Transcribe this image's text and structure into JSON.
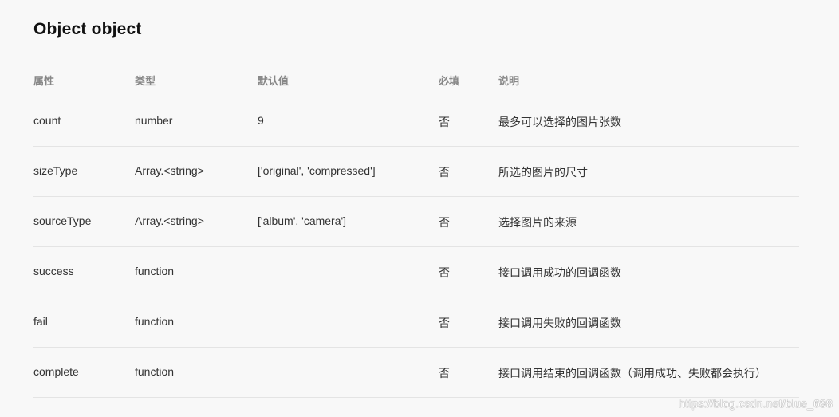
{
  "heading": "Object object",
  "columns": [
    "属性",
    "类型",
    "默认值",
    "必填",
    "说明"
  ],
  "rows": [
    {
      "name": "count",
      "type": "number",
      "default": "9",
      "required": "否",
      "description": "最多可以选择的图片张数"
    },
    {
      "name": "sizeType",
      "type": "Array.<string>",
      "default": "['original', 'compressed']",
      "required": "否",
      "description": "所选的图片的尺寸"
    },
    {
      "name": "sourceType",
      "type": "Array.<string>",
      "default": "['album', 'camera']",
      "required": "否",
      "description": "选择图片的来源"
    },
    {
      "name": "success",
      "type": "function",
      "default": "",
      "required": "否",
      "description": "接口调用成功的回调函数"
    },
    {
      "name": "fail",
      "type": "function",
      "default": "",
      "required": "否",
      "description": "接口调用失败的回调函数"
    },
    {
      "name": "complete",
      "type": "function",
      "default": "",
      "required": "否",
      "description": "接口调用结束的回调函数（调用成功、失败都会执行）"
    }
  ],
  "watermark": "https://blog.csdn.net/blue_698"
}
